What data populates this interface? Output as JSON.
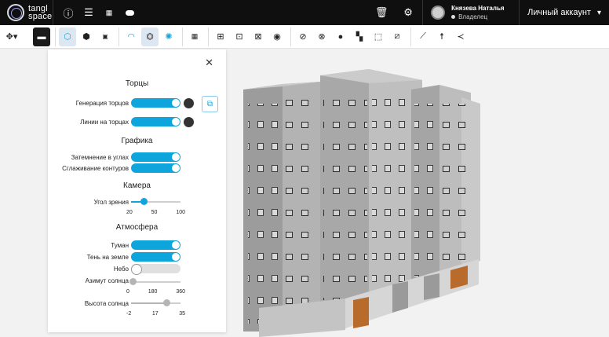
{
  "app": {
    "logo_line1": "tangl",
    "logo_line2": "space"
  },
  "topbar": {
    "icons": [
      "info-icon",
      "list-icon",
      "grid-icon",
      "toggle-icon"
    ],
    "right_icons": [
      "trash-icon",
      "settings-icon"
    ],
    "user_name": "Князева Наталья",
    "user_role": "Владелец",
    "account_label": "Личный аккаунт",
    "account_chevron": "⌄"
  },
  "panel": {
    "close_glyph": "✕",
    "sections": {
      "ends": "Торцы",
      "graphics": "Графика",
      "camera": "Камера",
      "atmosphere": "Атмосфера"
    },
    "rows": {
      "ends_generation": "Генерация торцов",
      "ends_lines": "Линии на торцах",
      "ambient_occlusion": "Затемнение в углах",
      "antialiasing": "Сглаживание контуров",
      "fov": "Угол зрения",
      "fog": "Туман",
      "ground_shadow": "Тень на земле",
      "sky": "Небо",
      "sun_azimuth": "Азимут солнца",
      "sun_altitude": "Высота солнца"
    },
    "toggles": {
      "ends_generation": true,
      "ends_lines": true,
      "ambient_occlusion": true,
      "antialiasing": true,
      "fog": true,
      "ground_shadow": true,
      "sky": false
    },
    "colors": {
      "ends_generation": "#333333",
      "ends_lines": "#333333",
      "accent": "#0ea5dd"
    },
    "sliders": {
      "fov": {
        "min": 10,
        "max": 110,
        "value": 35,
        "ticks": [
          "20",
          "50",
          "100"
        ]
      },
      "sun_azimuth": {
        "min": 0,
        "max": 360,
        "value": 10,
        "ticks": [
          "0",
          "180",
          "360"
        ]
      },
      "sun_altitude": {
        "min": -10,
        "max": 40,
        "value": 26,
        "ticks": [
          "-2",
          "17",
          "35"
        ]
      }
    }
  }
}
